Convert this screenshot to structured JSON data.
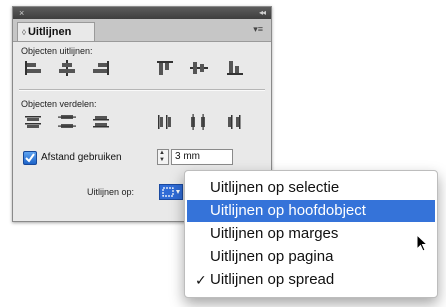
{
  "panel": {
    "close_glyph": "×",
    "collapse_glyph": "◂◂",
    "tab_arrows": "◊",
    "tab_label": "Uitlijnen",
    "menu_glyph": "▾≡",
    "section_align_label": "Objecten uitlijnen:",
    "section_distribute_label": "Objecten verdelen:",
    "align_icons": [
      "align-left-edges-icon",
      "align-horizontal-centers-icon",
      "align-right-edges-icon",
      "align-top-edges-icon",
      "align-vertical-centers-icon",
      "align-bottom-edges-icon"
    ],
    "distribute_icons": [
      "distribute-top-edges-icon",
      "distribute-vertical-centers-icon",
      "distribute-bottom-edges-icon",
      "distribute-left-edges-icon",
      "distribute-horizontal-centers-icon",
      "distribute-right-edges-icon"
    ],
    "use_spacing": {
      "label": "Afstand gebruiken",
      "checked": true
    },
    "spacing_value": "3 mm",
    "align_to_label": "Uitlijnen op:"
  },
  "dropdown": {
    "items": [
      {
        "label": "Uitlijnen op selectie",
        "selected": false,
        "highlighted": false
      },
      {
        "label": "Uitlijnen op hoofdobject",
        "selected": false,
        "highlighted": true
      },
      {
        "label": "Uitlijnen op marges",
        "selected": false,
        "highlighted": false
      },
      {
        "label": "Uitlijnen op pagina",
        "selected": false,
        "highlighted": false
      },
      {
        "label": "Uitlijnen op spread",
        "selected": true,
        "highlighted": false
      }
    ],
    "check_glyph": "✓"
  },
  "colors": {
    "highlight": "#3573d9",
    "checkbox": "#2f74d6",
    "panel_bg": "#e9e9e9"
  }
}
